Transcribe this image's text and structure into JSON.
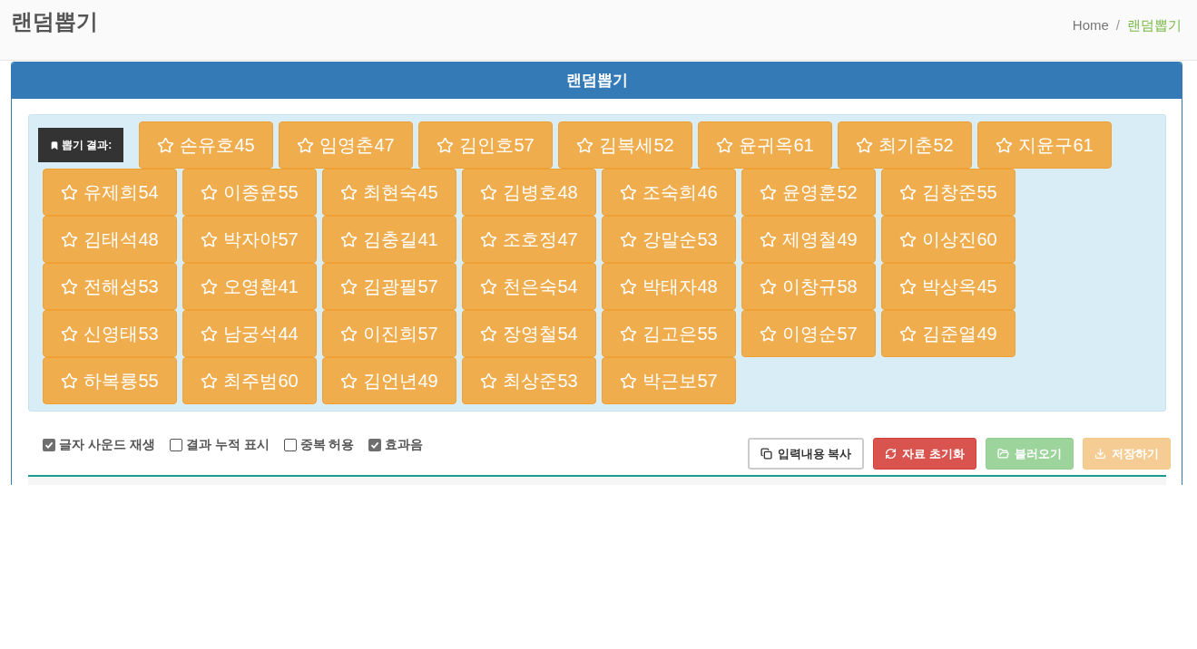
{
  "page_header": {
    "title": "랜덤뽑기",
    "breadcrumb": {
      "separator": "/",
      "items": [
        {
          "label": "Home",
          "selected": false
        },
        {
          "label": "랜덤뽑기",
          "selected": true
        }
      ]
    }
  },
  "panel": {
    "title": "랜덤뽑기",
    "result_label": "뽑기 결과:",
    "results": [
      "손유호45",
      "임영춘47",
      "김인호57",
      "김복세52",
      "윤귀옥61",
      "최기춘52",
      "지윤구61",
      "유제희54",
      "이종윤55",
      "최현숙45",
      "김병호48",
      "조숙희46",
      "윤영훈52",
      "김창준55",
      "김태석48",
      "박자야57",
      "김충길41",
      "조호정47",
      "강말순53",
      "제영철49",
      "이상진60",
      "전해성53",
      "오영환41",
      "김광필57",
      "천은숙54",
      "박태자48",
      "이창규58",
      "박상옥45",
      "신영태53",
      "남궁석44",
      "이진희57",
      "장영철54",
      "김고은55",
      "이영순57",
      "김준열49",
      "하복룡55",
      "최주범60",
      "김언년49",
      "최상준53",
      "박근보57"
    ],
    "options": [
      {
        "label": "글자 사운드 재생",
        "checked": true
      },
      {
        "label": "결과 누적 표시",
        "checked": false
      },
      {
        "label": "중복 허용",
        "checked": false
      },
      {
        "label": "효과음",
        "checked": true
      }
    ],
    "buttons": [
      {
        "label": "입력내용 복사",
        "kind": "copy",
        "disabled": false
      },
      {
        "label": "자료 초기화",
        "kind": "reset",
        "disabled": false
      },
      {
        "label": "불러오기",
        "kind": "load",
        "disabled": true
      },
      {
        "label": "저장하기",
        "kind": "save",
        "disabled": true
      }
    ]
  }
}
